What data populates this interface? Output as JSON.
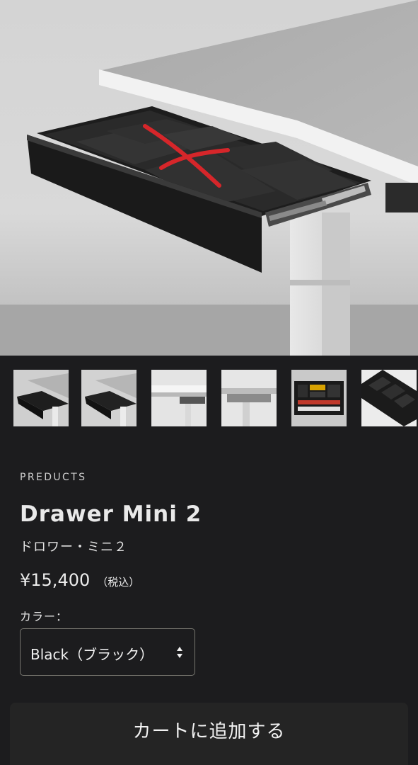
{
  "gallery": {
    "thumbnail_count": 6,
    "thumbnails": [
      "drawer-open-angle",
      "drawer-open-angle-2",
      "desk-side-view",
      "desk-underside-view",
      "drawer-with-stationery",
      "drawer-tray-closeup"
    ]
  },
  "product": {
    "category": "PREDUCTS",
    "name": "Drawer Mini 2",
    "name_ja": "ドロワー・ミニ２",
    "price": "¥15,400",
    "tax_note": "（税込）",
    "color_label": "カラー：",
    "color_selected": "Black（ブラック）"
  },
  "actions": {
    "add_to_cart": "カートに追加する"
  },
  "colors": {
    "background": "#1c1c1e",
    "annotation_cross": "#d6262a"
  }
}
